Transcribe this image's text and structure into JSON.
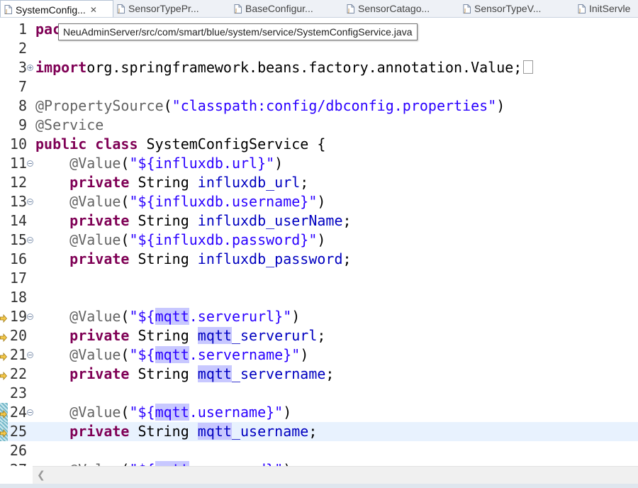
{
  "tabs": [
    {
      "label": "SystemConfig...",
      "close": "✕",
      "active": true
    },
    {
      "label": "SensorTypePr...",
      "active": false
    },
    {
      "label": "BaseConfigur...",
      "active": false
    },
    {
      "label": "SensorCatago...",
      "active": false
    },
    {
      "label": "SensorTypeV...",
      "active": false
    },
    {
      "label": "InitServle",
      "active": false
    }
  ],
  "tooltip": "NeuAdminServer/src/com/smart/blue/system/service/SystemConfigService.java",
  "lines": [
    {
      "n": "1",
      "tokens": [
        [
          "kw",
          "pac"
        ]
      ]
    },
    {
      "n": "2",
      "tokens": []
    },
    {
      "n": "3",
      "fold": "plus",
      "tokens": [
        [
          "kw",
          "import"
        ],
        [
          "",
          "org.springframework.beans.factory.annotation.Value;"
        ]
      ],
      "box": true
    },
    {
      "n": "7",
      "tokens": []
    },
    {
      "n": "8",
      "tokens": [
        [
          "ann",
          "@PropertySource"
        ],
        [
          "",
          "("
        ],
        [
          "str",
          "\"classpath:config/dbconfig.properties\""
        ],
        [
          "",
          ")"
        ]
      ]
    },
    {
      "n": "9",
      "tokens": [
        [
          "ann",
          "@Service"
        ]
      ]
    },
    {
      "n": "10",
      "tokens": [
        [
          "kw",
          "public"
        ],
        [
          "",
          " "
        ],
        [
          "kw",
          "class"
        ],
        [
          "",
          " SystemConfigService {"
        ]
      ]
    },
    {
      "n": "11",
      "fold": "minus",
      "tokens": [
        [
          "",
          "    "
        ],
        [
          "ann",
          "@Value"
        ],
        [
          "",
          "("
        ],
        [
          "str",
          "\"${influxdb.url}\""
        ],
        [
          "",
          ")"
        ]
      ]
    },
    {
      "n": "12",
      "tokens": [
        [
          "",
          "    "
        ],
        [
          "kw",
          "private"
        ],
        [
          "",
          " String "
        ],
        [
          "fld",
          "influxdb_url"
        ],
        [
          "",
          ";"
        ]
      ]
    },
    {
      "n": "13",
      "fold": "minus",
      "tokens": [
        [
          "",
          "    "
        ],
        [
          "ann",
          "@Value"
        ],
        [
          "",
          "("
        ],
        [
          "str",
          "\"${influxdb.username}\""
        ],
        [
          "",
          ")"
        ]
      ]
    },
    {
      "n": "14",
      "tokens": [
        [
          "",
          "    "
        ],
        [
          "kw",
          "private"
        ],
        [
          "",
          " String "
        ],
        [
          "fld",
          "influxdb_userName"
        ],
        [
          "",
          ";"
        ]
      ]
    },
    {
      "n": "15",
      "fold": "minus",
      "tokens": [
        [
          "",
          "    "
        ],
        [
          "ann",
          "@Value"
        ],
        [
          "",
          "("
        ],
        [
          "str",
          "\"${influxdb.password}\""
        ],
        [
          "",
          ")"
        ]
      ]
    },
    {
      "n": "16",
      "tokens": [
        [
          "",
          "    "
        ],
        [
          "kw",
          "private"
        ],
        [
          "",
          " String "
        ],
        [
          "fld",
          "influxdb_password"
        ],
        [
          "",
          ";"
        ]
      ]
    },
    {
      "n": "17",
      "tokens": []
    },
    {
      "n": "18",
      "tokens": []
    },
    {
      "n": "19",
      "marker": true,
      "fold": "minus",
      "tokens": [
        [
          "",
          "    "
        ],
        [
          "ann",
          "@Value"
        ],
        [
          "",
          "("
        ],
        [
          "str",
          "\"${"
        ],
        [
          "str hl",
          "mqtt"
        ],
        [
          "str",
          ".serverurl}\""
        ],
        [
          "",
          ")"
        ]
      ]
    },
    {
      "n": "20",
      "marker": true,
      "tokens": [
        [
          "",
          "    "
        ],
        [
          "kw",
          "private"
        ],
        [
          "",
          " String "
        ],
        [
          "fld hl",
          "mqtt"
        ],
        [
          "fld",
          "_serverurl"
        ],
        [
          "",
          ";"
        ]
      ]
    },
    {
      "n": "21",
      "marker": true,
      "fold": "minus",
      "tokens": [
        [
          "",
          "    "
        ],
        [
          "ann",
          "@Value"
        ],
        [
          "",
          "("
        ],
        [
          "str",
          "\"${"
        ],
        [
          "str hl",
          "mqtt"
        ],
        [
          "str",
          ".servername}\""
        ],
        [
          "",
          ")"
        ]
      ]
    },
    {
      "n": "22",
      "marker": true,
      "tokens": [
        [
          "",
          "    "
        ],
        [
          "kw",
          "private"
        ],
        [
          "",
          " String "
        ],
        [
          "fld hl",
          "mqtt"
        ],
        [
          "fld",
          "_servername"
        ],
        [
          "",
          ";"
        ]
      ]
    },
    {
      "n": "23",
      "tokens": []
    },
    {
      "n": "24",
      "marker": true,
      "changed": true,
      "fold": "minus",
      "tokens": [
        [
          "",
          "    "
        ],
        [
          "ann",
          "@Value"
        ],
        [
          "",
          "("
        ],
        [
          "str",
          "\"${"
        ],
        [
          "str hl",
          "mqtt"
        ],
        [
          "str",
          ".username}\""
        ],
        [
          "",
          ")"
        ]
      ]
    },
    {
      "n": "25",
      "marker": true,
      "changed": true,
      "current": true,
      "tokens": [
        [
          "",
          "    "
        ],
        [
          "kw",
          "private"
        ],
        [
          "",
          " String "
        ],
        [
          "fld hl",
          "mqtt"
        ],
        [
          "fld",
          "_username"
        ],
        [
          "",
          ";"
        ]
      ]
    },
    {
      "n": "26",
      "tokens": []
    },
    {
      "n": "27",
      "tokens": [
        [
          "",
          "    "
        ],
        [
          "ann",
          "@Value"
        ],
        [
          "",
          "("
        ],
        [
          "str",
          "\"${"
        ],
        [
          "str hl",
          "mqtt"
        ],
        [
          "str",
          ".password}\""
        ],
        [
          "",
          ")"
        ]
      ]
    }
  ],
  "icons": {
    "file": "java-file-icon",
    "marker": "search-result-arrow-icon",
    "scroll_left": "scroll-left-arrow-icon"
  },
  "colors": {
    "keyword": "#7f0055",
    "annotation": "#646464",
    "string": "#2a00ff",
    "field": "#0000c0",
    "occurrence_highlight": "#c8c8ff",
    "current_line": "#e8f2fe"
  }
}
